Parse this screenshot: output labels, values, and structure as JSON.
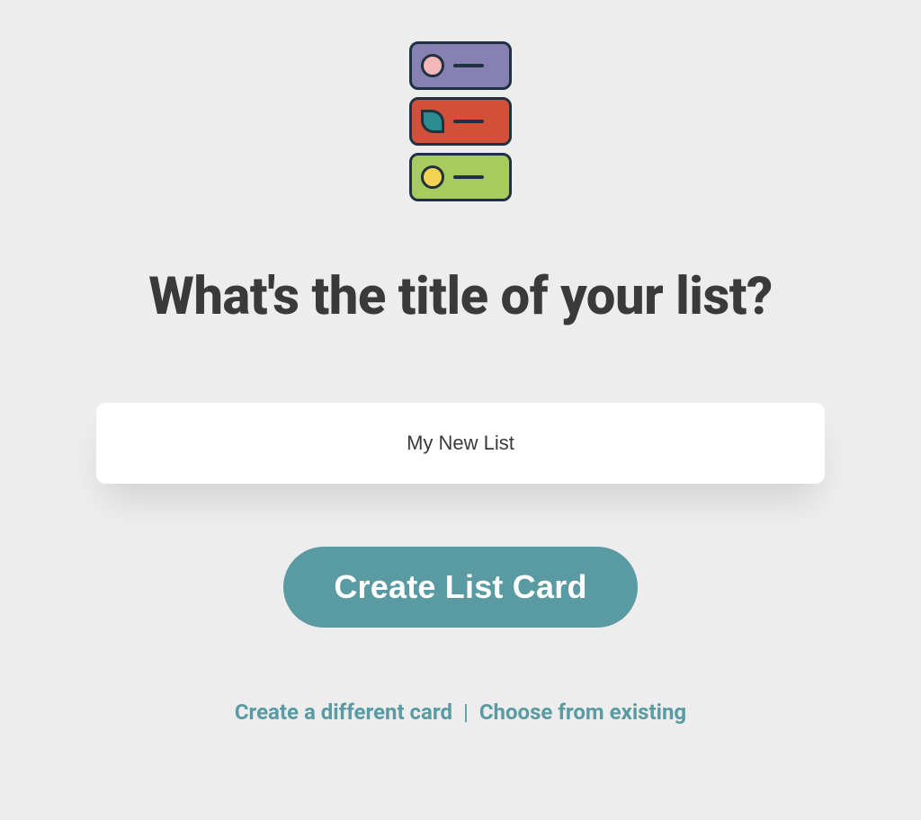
{
  "heading": "What's the title of your list?",
  "input": {
    "placeholder": "My New List",
    "value": ""
  },
  "primary_button_label": "Create List Card",
  "secondary": {
    "different_label": "Create a different card",
    "separator": "|",
    "existing_label": "Choose from existing"
  },
  "colors": {
    "accent": "#5a9aa2",
    "background": "#ededed",
    "text": "#3a3a3a"
  },
  "illustration_rows": [
    {
      "color": "purple",
      "icon": "pink-circle"
    },
    {
      "color": "red",
      "icon": "leaf"
    },
    {
      "color": "green",
      "icon": "yellow-circle"
    }
  ]
}
